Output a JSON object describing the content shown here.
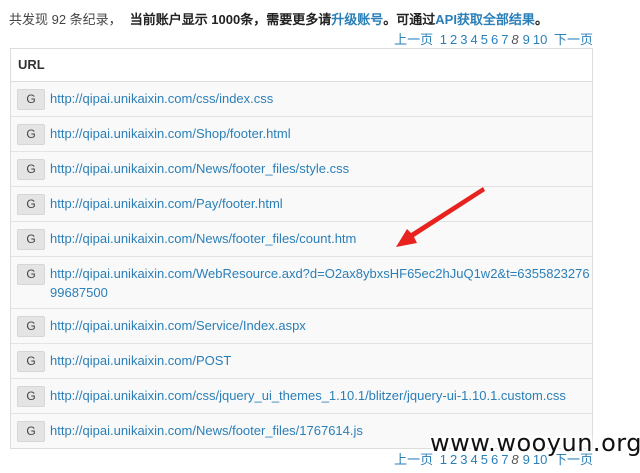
{
  "summary": {
    "prefix": "共发现 92 条纪录，",
    "account_limit": "当前账户显示 1000条，需要更多请",
    "upgrade_link": "升级账号",
    "middle": "。可通过",
    "api_link": "API获取全部结果",
    "suffix": "。"
  },
  "pager": {
    "prev": "上一页",
    "pages": [
      "1",
      "2",
      "3",
      "4",
      "5",
      "6",
      "7"
    ],
    "current": "8",
    "after": [
      "9",
      "10"
    ],
    "next": "下一页"
  },
  "table": {
    "header": "URL",
    "badge": "G",
    "rows": [
      "http://qipai.unikaixin.com/css/index.css",
      "http://qipai.unikaixin.com/Shop/footer.html",
      "http://qipai.unikaixin.com/News/footer_files/style.css",
      "http://qipai.unikaixin.com/Pay/footer.html",
      "http://qipai.unikaixin.com/News/footer_files/count.htm",
      "http://qipai.unikaixin.com/WebResource.axd?d=O2ax8ybxsHF65ec2hJuQ1w2&t=635582327699687500",
      "http://qipai.unikaixin.com/Service/Index.aspx",
      "http://qipai.unikaixin.com/POST",
      "http://qipai.unikaixin.com/css/jquery_ui_themes_1.10.1/blitzer/jquery-ui-1.10.1.custom.css",
      "http://qipai.unikaixin.com/News/footer_files/1767614.js"
    ]
  },
  "annotation": {
    "arrow_color": "#e8231f"
  },
  "watermark": "www.wooyun.org"
}
